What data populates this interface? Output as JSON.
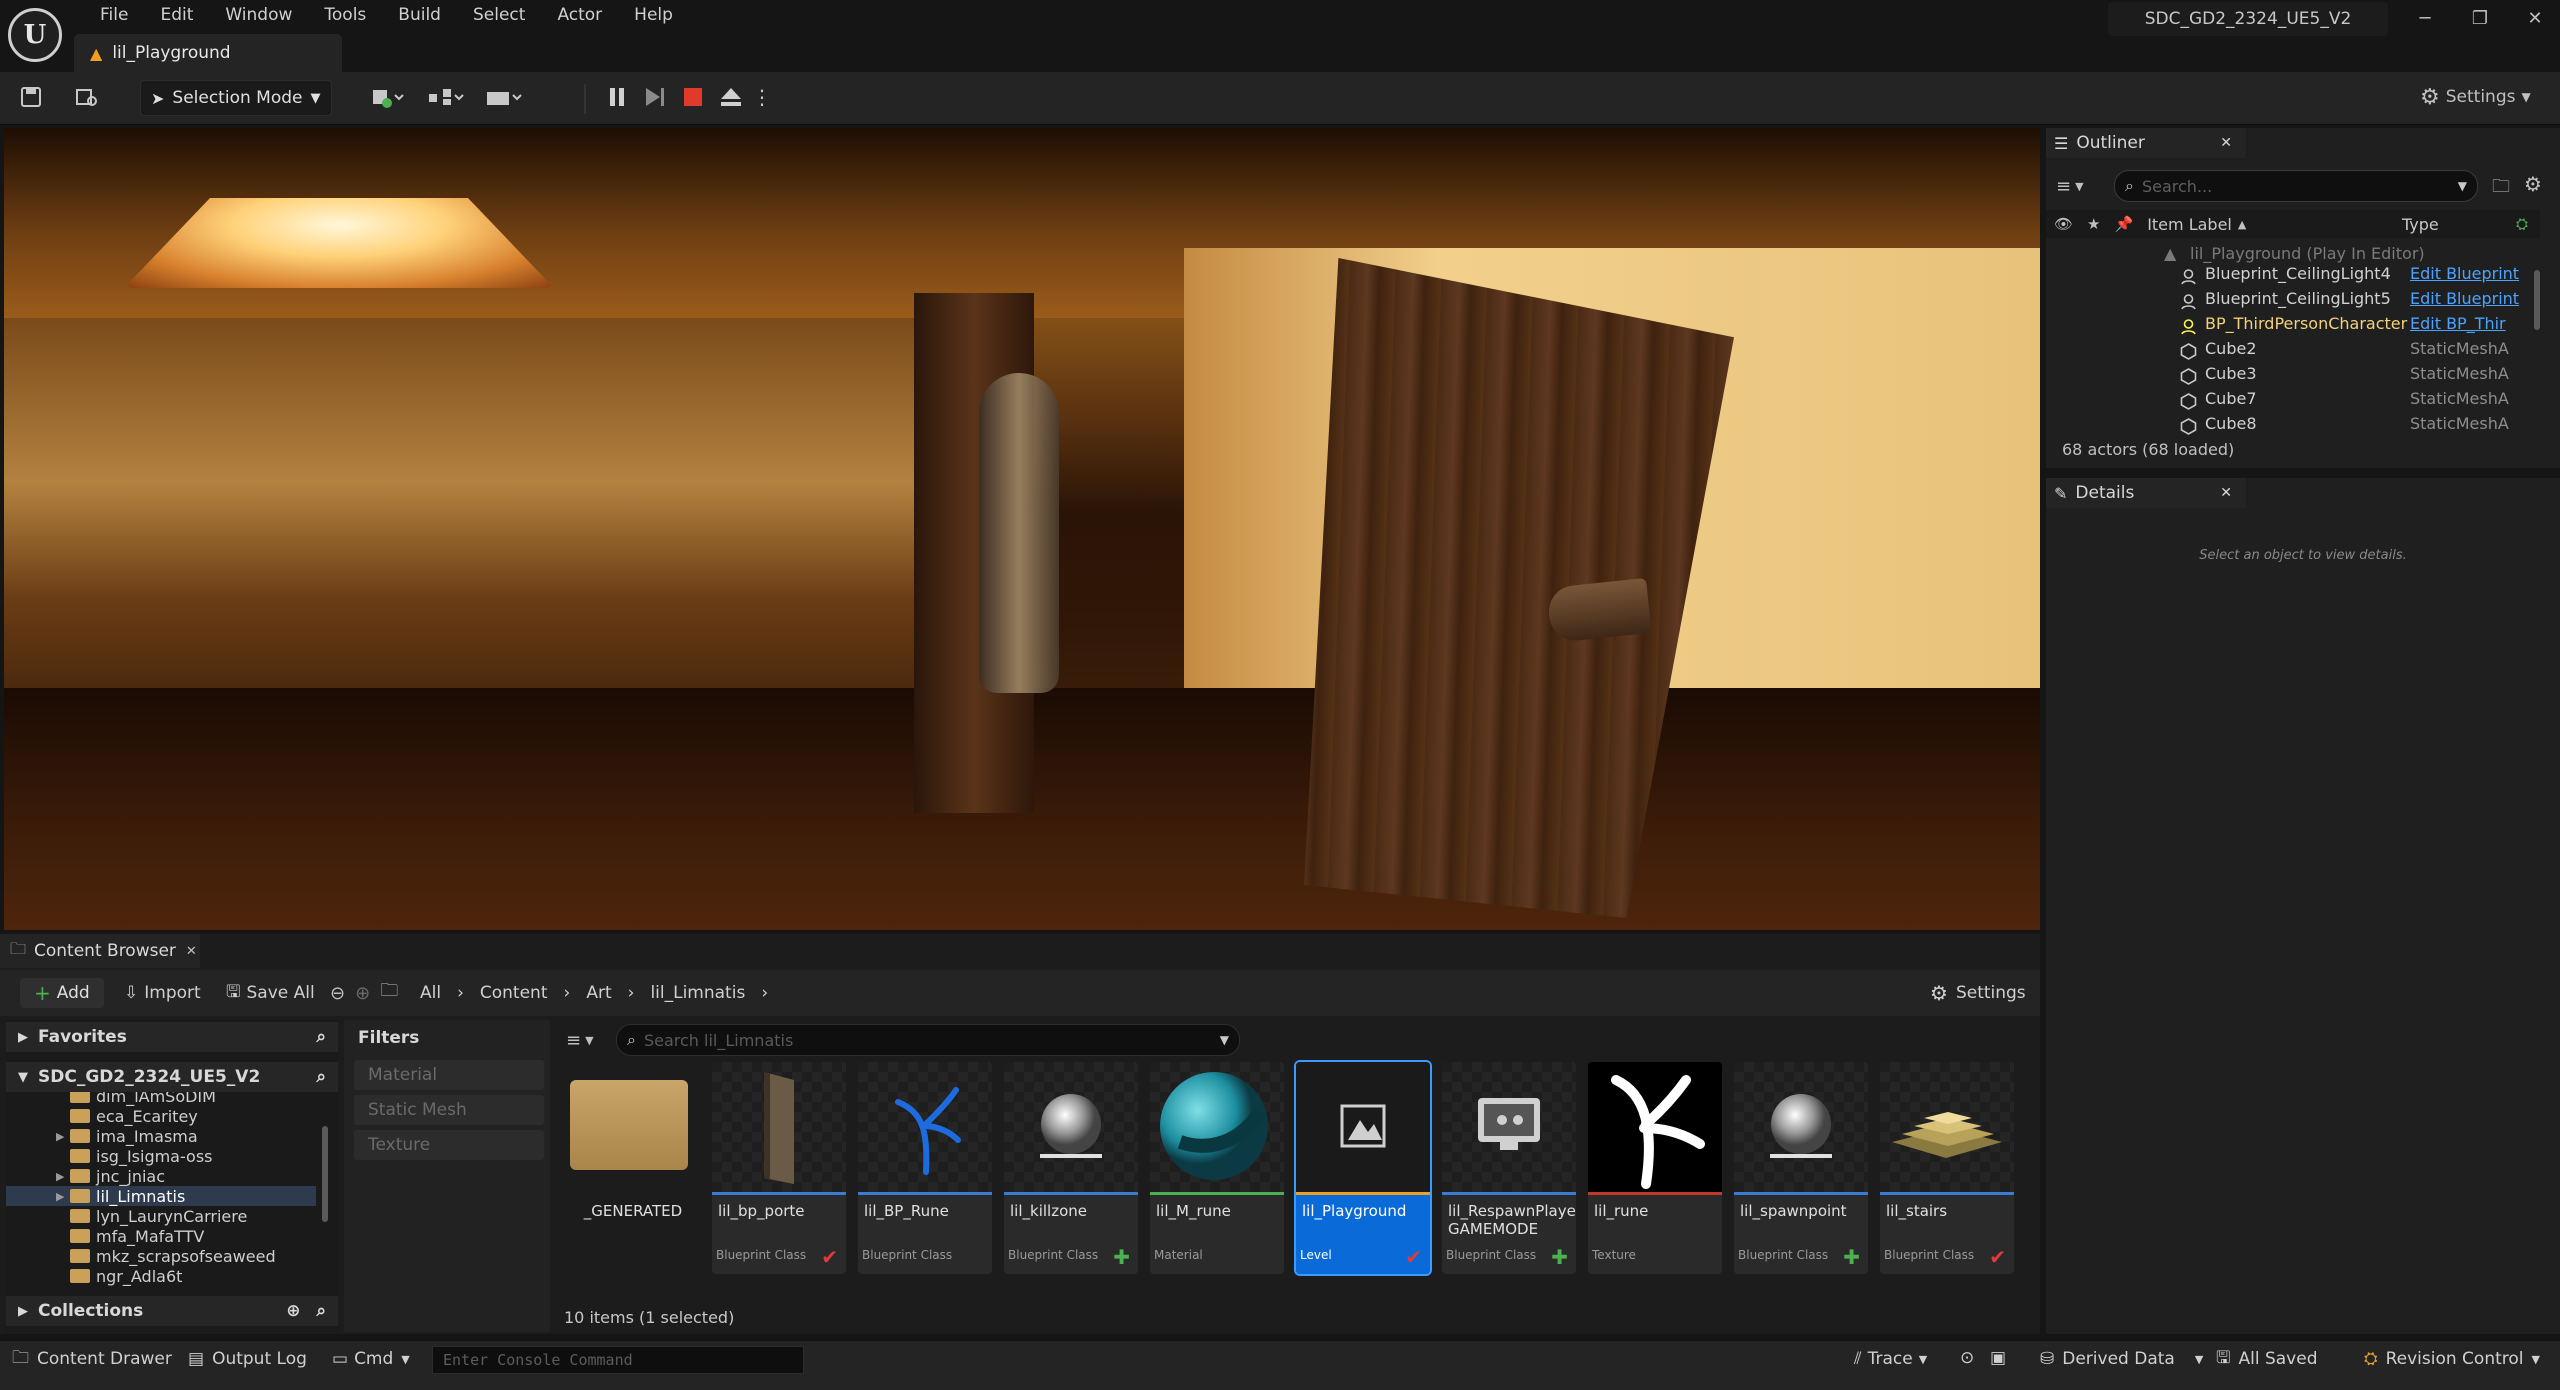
{
  "app": {
    "menu": [
      "File",
      "Edit",
      "Window",
      "Tools",
      "Build",
      "Select",
      "Actor",
      "Help"
    ],
    "document_tab": "lil_Playground",
    "project_name": "SDC_GD2_2324_UE5_V2"
  },
  "toolbar": {
    "selection_mode": "Selection Mode",
    "settings_label": "Settings"
  },
  "outliner": {
    "tab_label": "Outliner",
    "search_placeholder": "Search...",
    "col_item_label": "Item Label",
    "col_type": "Type",
    "level_row": "lil_Playground (Play In Editor)",
    "rows": [
      {
        "label": "Blueprint_CeilingLight4",
        "type": "Edit Blueprint",
        "link": true
      },
      {
        "label": "Blueprint_CeilingLight5",
        "type": "Edit Blueprint",
        "link": true
      },
      {
        "label": "BP_ThirdPersonCharacter",
        "type": "Edit BP_Thir",
        "link": true
      },
      {
        "label": "Cube2",
        "type": "StaticMeshA",
        "link": false
      },
      {
        "label": "Cube3",
        "type": "StaticMeshA",
        "link": false
      },
      {
        "label": "Cube7",
        "type": "StaticMeshA",
        "link": false
      },
      {
        "label": "Cube8",
        "type": "StaticMeshA",
        "link": false
      }
    ],
    "actor_count": "68 actors (68 loaded)"
  },
  "details": {
    "tab_label": "Details",
    "empty_hint": "Select an object to view details."
  },
  "content_browser": {
    "tab_label": "Content Browser",
    "add_label": "Add",
    "import_label": "Import",
    "save_all_label": "Save All",
    "breadcrumb": [
      "All",
      "Content",
      "Art",
      "lil_Limnatis"
    ],
    "settings_label": "Settings",
    "favorites_label": "Favorites",
    "project_root": "SDC_GD2_2324_UE5_V2",
    "folders": [
      {
        "name": "dim_lAmSoDIM",
        "expandable": false,
        "selected": false
      },
      {
        "name": "eca_Ecaritey",
        "expandable": false,
        "selected": false
      },
      {
        "name": "ima_Imasma",
        "expandable": true,
        "selected": false
      },
      {
        "name": "isg_Isigma-oss",
        "expandable": false,
        "selected": false
      },
      {
        "name": "jnc_jniac",
        "expandable": true,
        "selected": false
      },
      {
        "name": "lil_Limnatis",
        "expandable": true,
        "selected": true
      },
      {
        "name": "lyn_LaurynCarriere",
        "expandable": false,
        "selected": false
      },
      {
        "name": "mfa_MafaTTV",
        "expandable": false,
        "selected": false
      },
      {
        "name": "mkz_scrapsofseaweed",
        "expandable": false,
        "selected": false
      },
      {
        "name": "ngr_Adla6t",
        "expandable": false,
        "selected": false
      }
    ],
    "collections_label": "Collections",
    "filters_label": "Filters",
    "filters": [
      "Material",
      "Static Mesh",
      "Texture"
    ],
    "search_placeholder": "Search lil_Limnatis",
    "assets": [
      {
        "name": "_GENERATED",
        "class": "",
        "kind": "folder",
        "bar": "",
        "badge": ""
      },
      {
        "name": "lil_bp_porte",
        "class": "Blueprint Class",
        "kind": "door",
        "bar": "#3a7bd5",
        "badge": "check"
      },
      {
        "name": "lil_BP_Rune",
        "class": "Blueprint Class",
        "kind": "rune-blue",
        "bar": "#3a7bd5",
        "badge": ""
      },
      {
        "name": "lil_killzone",
        "class": "Blueprint Class",
        "kind": "sphere",
        "bar": "#3a7bd5",
        "badge": "plus"
      },
      {
        "name": "lil_M_rune",
        "class": "Material",
        "kind": "material",
        "bar": "#4caf50",
        "badge": ""
      },
      {
        "name": "lil_Playground",
        "class": "Level",
        "kind": "level",
        "bar": "#f0a020",
        "badge": "check",
        "selected": true
      },
      {
        "name": "lil_RespawnPlayer GAMEMODE",
        "class": "Blueprint Class",
        "kind": "gamemode",
        "bar": "#3a7bd5",
        "badge": "plus"
      },
      {
        "name": "lil_rune",
        "class": "Texture",
        "kind": "texture",
        "bar": "#c0392b",
        "badge": ""
      },
      {
        "name": "lil_spawnpoint",
        "class": "Blueprint Class",
        "kind": "sphere",
        "bar": "#3a7bd5",
        "badge": "plus"
      },
      {
        "name": "lil_stairs",
        "class": "Blueprint Class",
        "kind": "stairs",
        "bar": "#3a7bd5",
        "badge": "check"
      }
    ],
    "item_count": "10 items (1 selected)"
  },
  "statusbar": {
    "content_drawer": "Content Drawer",
    "output_log": "Output Log",
    "cmd": "Cmd",
    "console_placeholder": "Enter Console Command",
    "trace": "Trace",
    "derived_data": "Derived Data",
    "all_saved": "All Saved",
    "revision_control": "Revision Control"
  }
}
